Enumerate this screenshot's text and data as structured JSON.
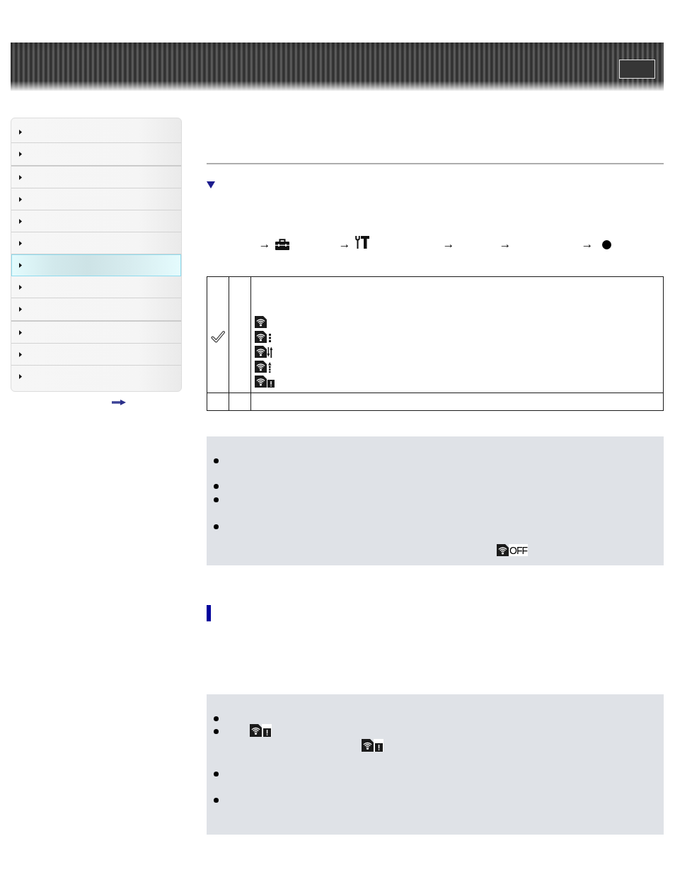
{
  "sidebar": {
    "groups": [
      {
        "items": [
          {
            "selected": false
          },
          {
            "selected": false
          }
        ]
      },
      {
        "items": [
          {
            "selected": false
          },
          {
            "selected": false
          },
          {
            "selected": false
          },
          {
            "selected": false
          },
          {
            "selected": true
          },
          {
            "selected": false
          },
          {
            "selected": false
          }
        ]
      },
      {
        "items": [
          {
            "selected": false
          },
          {
            "selected": false
          },
          {
            "selected": false
          }
        ]
      }
    ]
  },
  "procedure": {
    "arrows": [
      "→",
      "→",
      "→",
      "→",
      "→"
    ]
  },
  "table": {
    "rows": [
      {
        "selected": true,
        "kind": "status_icons"
      },
      {
        "selected": false,
        "kind": "plain"
      }
    ]
  },
  "note": {
    "icon_label": "OFF"
  }
}
